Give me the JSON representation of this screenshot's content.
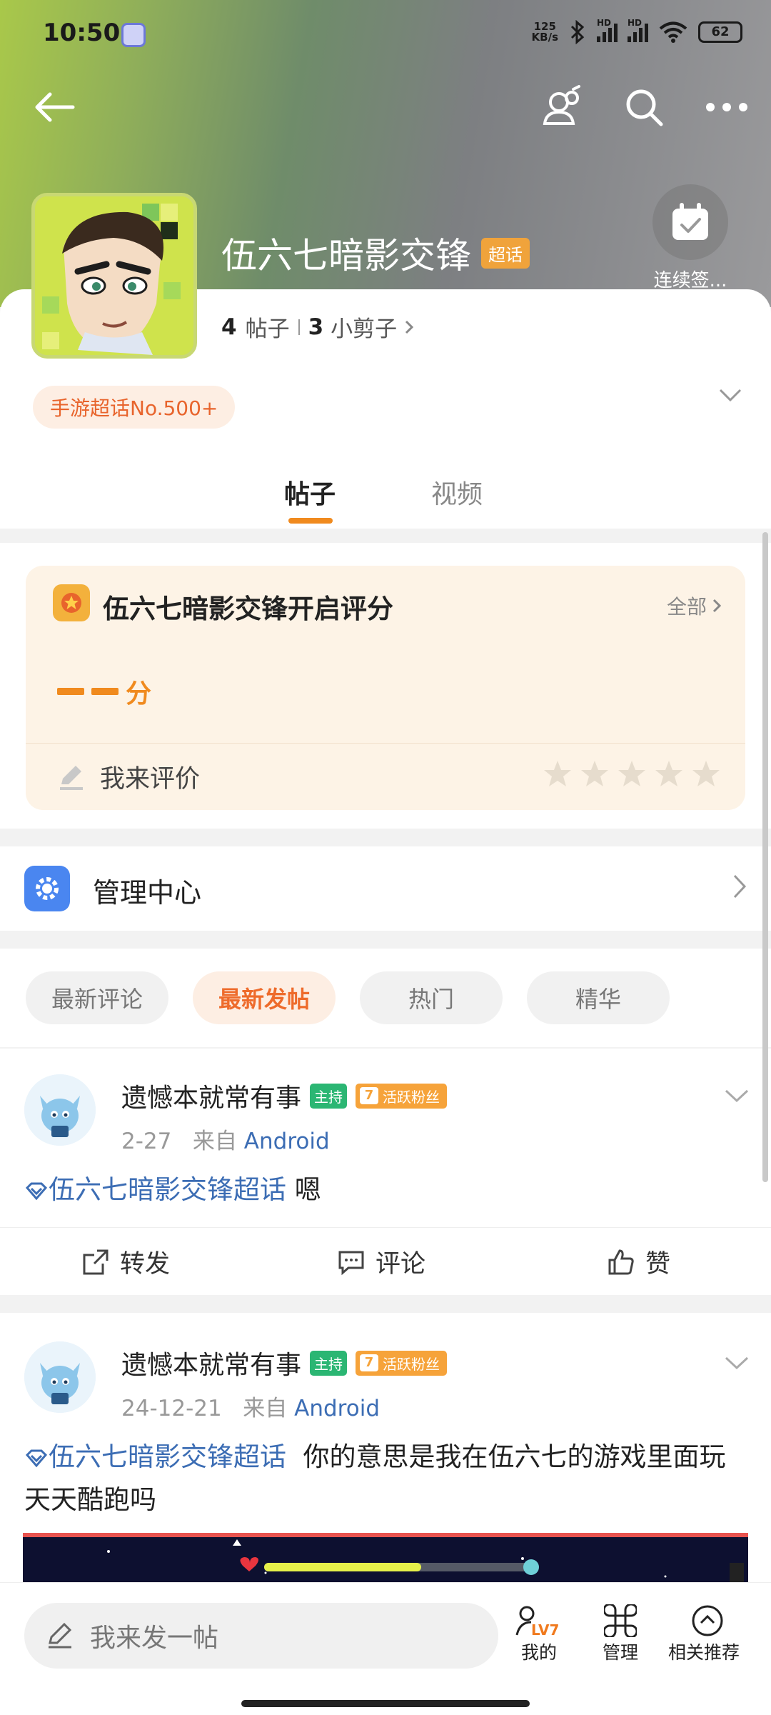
{
  "status_bar": {
    "time": "10:50",
    "net_speed_value": "125",
    "net_speed_unit": "KB/s",
    "sig1_label": "HD",
    "sig2_label": "HD",
    "battery": "62"
  },
  "header": {
    "topic_title": "伍六七暗影交锋",
    "badge": "超话",
    "checkin_label": "连续签...",
    "posts_count": "4",
    "posts_label": "帖子",
    "clips_count": "3",
    "clips_label": "小剪子",
    "rank_chip": "手游超话No.500+"
  },
  "tabs": [
    {
      "label": "帖子",
      "active": true
    },
    {
      "label": "视频",
      "active": false
    }
  ],
  "rating": {
    "title": "伍六七暗影交锋开启评分",
    "all_label": "全部",
    "score_unit": "分",
    "rate_me": "我来评价",
    "stars_filled": 0,
    "stars_total": 5
  },
  "management": {
    "label": "管理中心"
  },
  "filters": [
    {
      "label": "最新评论",
      "active": false
    },
    {
      "label": "最新发帖",
      "active": true
    },
    {
      "label": "热门",
      "active": false
    },
    {
      "label": "精华",
      "active": false
    }
  ],
  "posts": [
    {
      "author": "遗憾本就常有事",
      "host_badge": "主持",
      "fan_level": "7",
      "fan_badge": "活跃粉丝",
      "date": "2-27",
      "from_label": "来自",
      "source": "Android",
      "topic_link": "伍六七暗影交锋超话",
      "text": "嗯"
    },
    {
      "author": "遗憾本就常有事",
      "host_badge": "主持",
      "fan_level": "7",
      "fan_badge": "活跃粉丝",
      "date": "24-12-21",
      "from_label": "来自",
      "source": "Android",
      "topic_link": "伍六七暗影交锋超话",
      "text": "你的意思是我在伍六七的游戏里面玩天天酷跑吗"
    }
  ],
  "actions": {
    "repost": "转发",
    "comment": "评论",
    "like": "赞"
  },
  "bottom_bar": {
    "compose_placeholder": "我来发一帖",
    "mine_label": "我的",
    "mine_level": "LV7",
    "manage_label": "管理",
    "recommend_label": "相关推荐"
  },
  "colors": {
    "accent_orange": "#f08a1e",
    "link_blue": "#3c6db4",
    "host_green": "#2bb673",
    "mgmt_blue": "#4a86f0"
  }
}
